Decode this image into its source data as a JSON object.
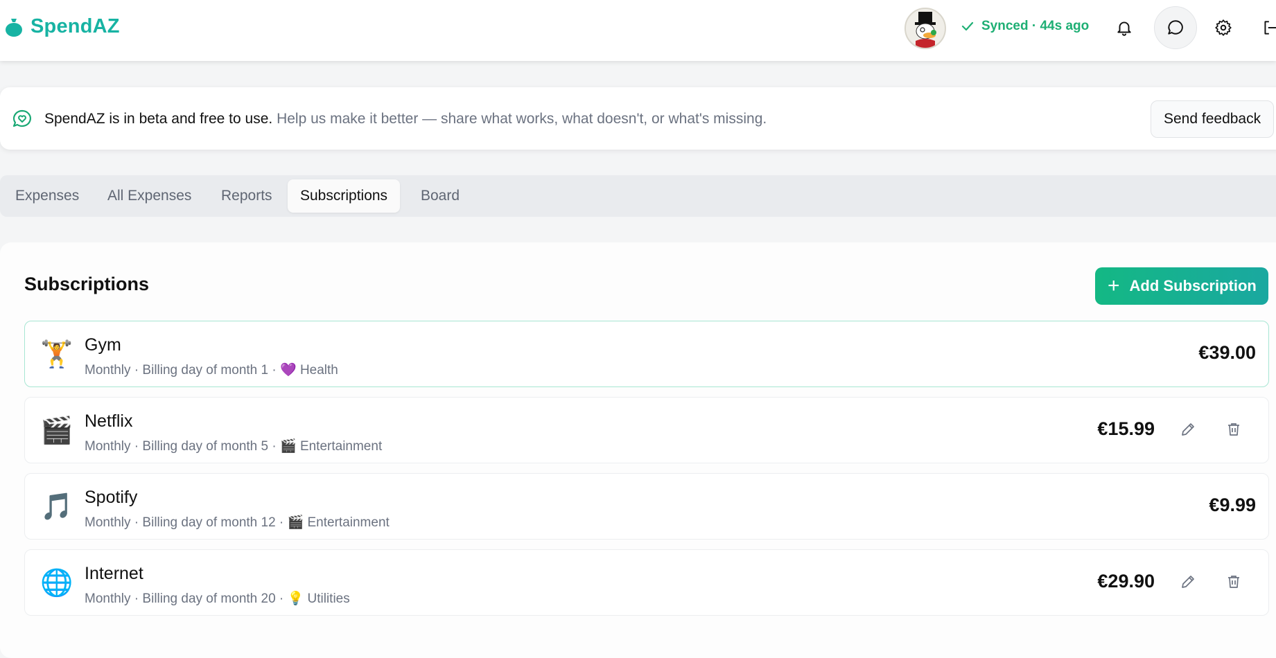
{
  "app": {
    "name": "SpendAZ",
    "brand_color": "#17b3a3"
  },
  "header": {
    "sync_status": "Synced · 44s ago",
    "sync_color": "#1eaf74",
    "icons": [
      "bell-icon",
      "chat-icon",
      "gear-icon",
      "logout-icon"
    ]
  },
  "banner": {
    "strong_text": "SpendAZ is in beta and free to use.",
    "muted_text": "Help us make it better — share what works, what doesn't, or what's missing.",
    "button_label": "Send feedback"
  },
  "tabs": [
    {
      "label": "Expenses",
      "active": false
    },
    {
      "label": "All Expenses",
      "active": false
    },
    {
      "label": "Reports",
      "active": false
    },
    {
      "label": "Subscriptions",
      "active": true
    },
    {
      "label": "Board",
      "active": false
    }
  ],
  "subscriptions": {
    "title": "Subscriptions",
    "add_button_label": "Add Subscription",
    "accent_gradient": [
      "#14b884",
      "#1aa8a0"
    ],
    "items": [
      {
        "emoji": "🏋️",
        "name": "Gym",
        "frequency": "Monthly",
        "billing": "Billing day of month 1",
        "category_emoji": "💜",
        "category": "Health",
        "price": "€39.00",
        "actions_visible": false
      },
      {
        "emoji": "🎬",
        "name": "Netflix",
        "frequency": "Monthly",
        "billing": "Billing day of month 5",
        "category_emoji": "🎬",
        "category": "Entertainment",
        "price": "€15.99",
        "actions_visible": true
      },
      {
        "emoji": "🎵",
        "name": "Spotify",
        "frequency": "Monthly",
        "billing": "Billing day of month 12",
        "category_emoji": "🎬",
        "category": "Entertainment",
        "price": "€9.99",
        "actions_visible": false
      },
      {
        "emoji": "🌐",
        "name": "Internet",
        "frequency": "Monthly",
        "billing": "Billing day of month 20",
        "category_emoji": "💡",
        "category": "Utilities",
        "price": "€29.90",
        "actions_visible": true
      }
    ]
  }
}
